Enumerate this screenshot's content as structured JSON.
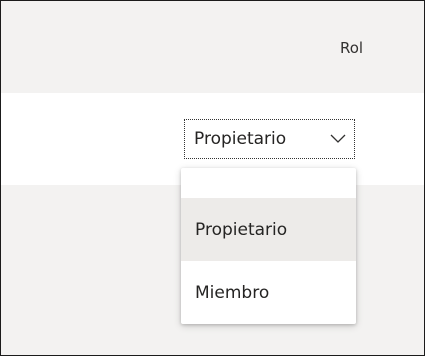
{
  "table": {
    "role_column_header": "Rol"
  },
  "role_select": {
    "value": "Propietario",
    "chevron_icon": "chevron-down-icon"
  },
  "role_menu": {
    "options": [
      {
        "label": "Propietario",
        "highlighted": true
      },
      {
        "label": "Miembro",
        "highlighted": false
      }
    ]
  },
  "colors": {
    "header_background": "#f3f2f1",
    "row_background": "#ffffff",
    "hover_background": "#edebe9",
    "text": "#252423"
  }
}
